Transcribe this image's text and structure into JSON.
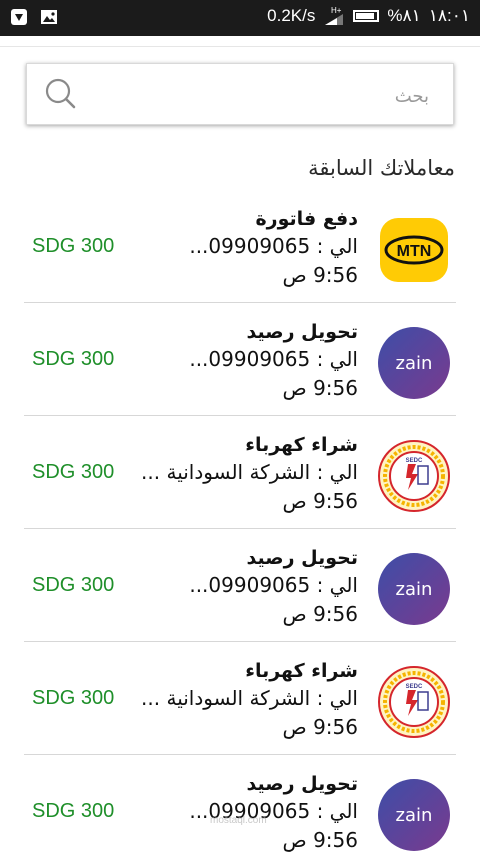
{
  "status_bar": {
    "net_speed": "0.2K/s",
    "network_type": "H+",
    "battery_percent_label": "%٨١",
    "battery_level": 0.81,
    "time": "١٨:٠١"
  },
  "search": {
    "placeholder": "بحث"
  },
  "section_title": "معاملاتك السابقة",
  "transactions": [
    {
      "title": "دفع فاتورة",
      "to": "الي : 09909065...",
      "time": "9:56 ص",
      "amount": "SDG 300",
      "logo": "mtn-logo",
      "logo_text": "MTN"
    },
    {
      "title": "تحويل رصيد",
      "to": "الي : 09909065...",
      "time": "9:56 ص",
      "amount": "SDG 300",
      "logo": "zain-logo",
      "logo_text": "zain"
    },
    {
      "title": "شراء كهرباء",
      "to": "الي : الشركة السودانية ...",
      "time": "9:56 ص",
      "amount": "SDG 300",
      "logo": "sedc-logo",
      "logo_text": "SEDC"
    },
    {
      "title": "تحويل رصيد",
      "to": "الي : 09909065...",
      "time": "9:56 ص",
      "amount": "SDG 300",
      "logo": "zain-logo",
      "logo_text": "zain"
    },
    {
      "title": "شراء كهرباء",
      "to": "الي : الشركة السودانية ...",
      "time": "9:56 ص",
      "amount": "SDG 300",
      "logo": "sedc-logo",
      "logo_text": "SEDC"
    },
    {
      "title": "تحويل رصيد",
      "to": "الي : 09909065...",
      "time": "9:56 ص",
      "amount": "SDG 300",
      "logo": "zain-logo",
      "logo_text": "zain"
    }
  ],
  "watermark": "mostaql.com",
  "colors": {
    "amount": "#1f8f2a",
    "mtn_yellow": "#ffcb05",
    "zain_purple": "#5a3d9a",
    "sedc_red": "#d5262c"
  }
}
